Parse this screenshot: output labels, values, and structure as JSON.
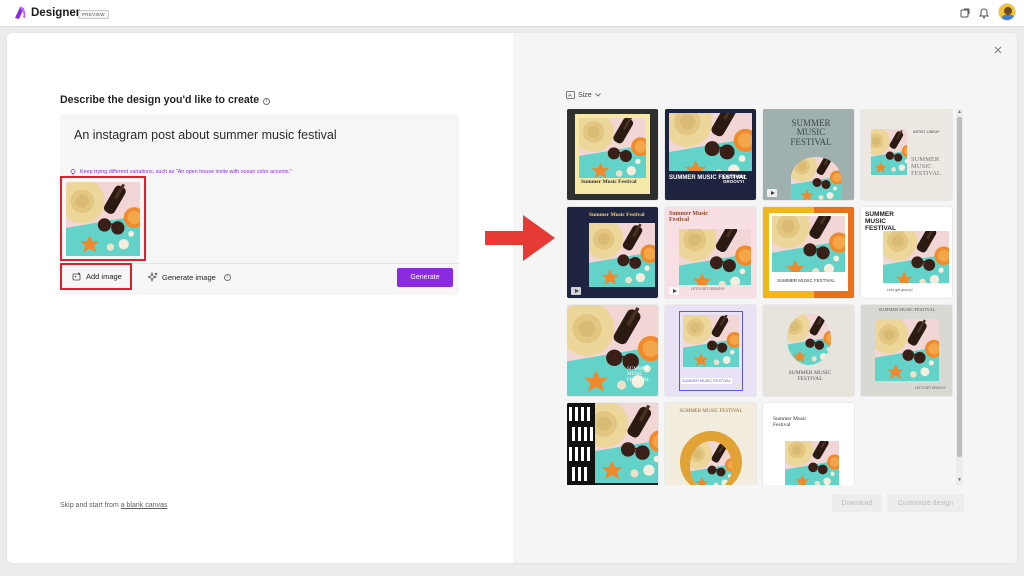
{
  "header": {
    "app_name": "Designer",
    "badge": "PREVIEW",
    "brand_color": "#8a2be2"
  },
  "left": {
    "heading": "Describe the design you'd like to create",
    "prompt": "An instagram post about summer music festival",
    "hint": "Keep trying different variations, such as \"An open house invite with ocean color accents.\"",
    "add_image_label": "Add image",
    "generate_image_label": "Generate image",
    "generate_button": "Generate",
    "skip_prefix": "Skip and start from",
    "skip_link": "a blank canvas"
  },
  "right": {
    "size_label": "Size",
    "download_button": "Download",
    "customize_button": "Customize design",
    "cards": [
      {
        "text": "Summer Music Festival"
      },
      {
        "text": "SUMMER MUSIC FESTIVAL",
        "sub": "LET'S GET GROOVY!"
      },
      {
        "text": "SUMMER MUSIC FESTIVAL"
      },
      {
        "text": "SUMMER MUSIC FESTIVAL",
        "sub": "ARTIST LINEUP"
      },
      {
        "text": "Summer Music Festival"
      },
      {
        "text": "Summer Music Festival",
        "sub": "LET'S GET GROOVY"
      },
      {
        "text": "SUMMER MUSIC FESTIVAL"
      },
      {
        "text": "SUMMER MUSIC FESTIVAL",
        "sub": "Let's get groovy!"
      },
      {
        "text": "SUMMER MUSIC FESTIVAL"
      },
      {
        "text": "SUMMER MUSIC FESTIVAL"
      },
      {
        "text": "SUMMER MUSIC FESTIVAL"
      },
      {
        "text": "SUMMER MUSIC FESTIVAL",
        "sub": "LET'S GET GROOVY"
      },
      {
        "text": ""
      },
      {
        "text": "SUMMER MUSIC FESTIVAL"
      },
      {
        "text": "Summer Music Festival"
      }
    ]
  },
  "colors": {
    "accent": "#8a2be2",
    "highlight": "#e0212b"
  }
}
